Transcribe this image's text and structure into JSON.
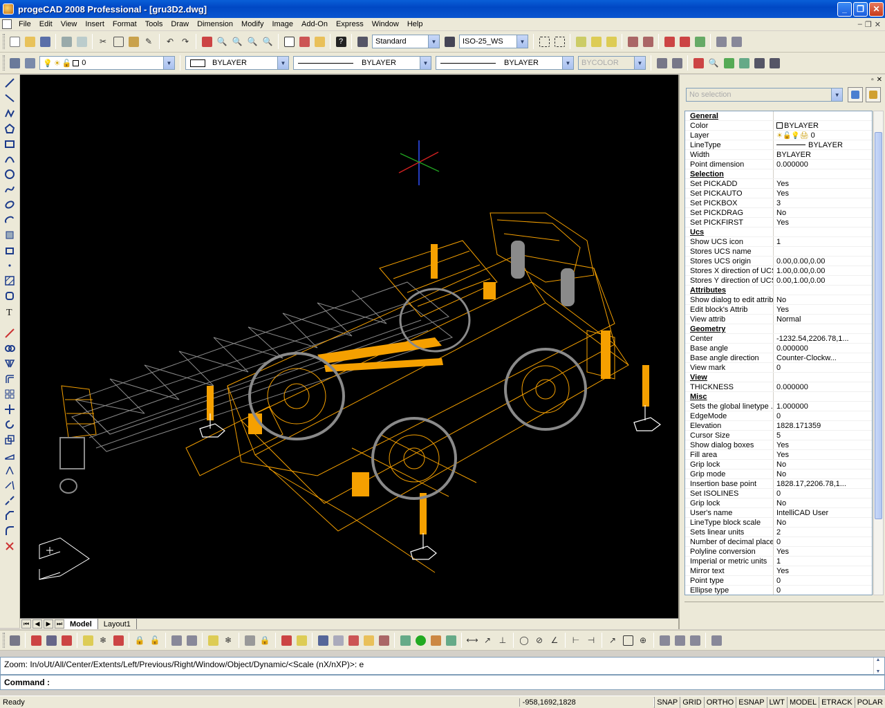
{
  "window": {
    "title": "progeCAD 2008 Professional - [gru3D2.dwg]"
  },
  "menu": [
    "File",
    "Edit",
    "View",
    "Insert",
    "Format",
    "Tools",
    "Draw",
    "Dimension",
    "Modify",
    "Image",
    "Add-On",
    "Express",
    "Window",
    "Help"
  ],
  "toolbar1": {
    "text_style": "Standard",
    "dim_style": "ISO-25_WS"
  },
  "toolbar2": {
    "layer": "0",
    "color": "BYLAYER",
    "linetype": "BYLAYER",
    "lineweight": "BYLAYER",
    "plotstyle": "BYCOLOR"
  },
  "properties": {
    "selection": "No selection",
    "rows": [
      {
        "k": "General",
        "v": "",
        "section": true
      },
      {
        "k": "Color",
        "v": "BYLAYER",
        "icon": "swatch"
      },
      {
        "k": "Layer",
        "v": "0",
        "icon": "layer"
      },
      {
        "k": "LineType",
        "v": "BYLAYER",
        "icon": "line"
      },
      {
        "k": "Width",
        "v": "BYLAYER"
      },
      {
        "k": "Point dimension",
        "v": "0.000000"
      },
      {
        "k": "Selection",
        "v": "",
        "section": true
      },
      {
        "k": "Set PICKADD",
        "v": "Yes"
      },
      {
        "k": "Set PICKAUTO",
        "v": "Yes"
      },
      {
        "k": "Set PICKBOX",
        "v": "3"
      },
      {
        "k": "Set PICKDRAG",
        "v": "No"
      },
      {
        "k": "Set PICKFIRST",
        "v": "Yes"
      },
      {
        "k": "Ucs",
        "v": "",
        "section": true
      },
      {
        "k": "Show UCS icon",
        "v": "1"
      },
      {
        "k": "Stores UCS name",
        "v": ""
      },
      {
        "k": "Stores UCS origin",
        "v": "0.00,0.00,0.00"
      },
      {
        "k": "Stores X direction of UCS",
        "v": "1.00,0.00,0.00"
      },
      {
        "k": "Stores Y direction of UCS",
        "v": "0.00,1.00,0.00"
      },
      {
        "k": "Attributes",
        "v": "",
        "section": true
      },
      {
        "k": "Show dialog to edit attrib",
        "v": "No"
      },
      {
        "k": "Edit block's Attrib",
        "v": "Yes"
      },
      {
        "k": "View attrib",
        "v": "Normal"
      },
      {
        "k": "Geometry",
        "v": "",
        "section": true
      },
      {
        "k": "Center",
        "v": "-1232.54,2206.78,1..."
      },
      {
        "k": "Base angle",
        "v": "0.000000"
      },
      {
        "k": "Base angle direction",
        "v": "Counter-Clockw..."
      },
      {
        "k": "View mark",
        "v": "0"
      },
      {
        "k": "View",
        "v": "",
        "section": true
      },
      {
        "k": "THICKNESS",
        "v": "0.000000"
      },
      {
        "k": "Misc",
        "v": "",
        "section": true
      },
      {
        "k": "Sets the global linetype ...",
        "v": "1.000000"
      },
      {
        "k": "EdgeMode",
        "v": "0"
      },
      {
        "k": "Elevation",
        "v": "1828.171359"
      },
      {
        "k": "Cursor Size",
        "v": "5"
      },
      {
        "k": "Show dialog boxes",
        "v": "Yes"
      },
      {
        "k": "Fill area",
        "v": "Yes"
      },
      {
        "k": "Grip lock",
        "v": "No"
      },
      {
        "k": "Grip mode",
        "v": "No"
      },
      {
        "k": "Insertion base point",
        "v": "1828.17,2206.78,1..."
      },
      {
        "k": "Set ISOLINES",
        "v": "0"
      },
      {
        "k": "Grip lock",
        "v": "No"
      },
      {
        "k": "User's name",
        "v": "IntelliCAD User"
      },
      {
        "k": "LineType block scale",
        "v": "No"
      },
      {
        "k": "Sets linear units",
        "v": "2"
      },
      {
        "k": "Number of decimal places",
        "v": "0"
      },
      {
        "k": "Polyline conversion",
        "v": "Yes"
      },
      {
        "k": "Imperial or metric units",
        "v": "1"
      },
      {
        "k": "Mirror text",
        "v": "Yes"
      },
      {
        "k": "Point type",
        "v": "0"
      },
      {
        "k": "Ellipse type",
        "v": "0"
      }
    ]
  },
  "tabs": [
    "Model",
    "Layout1"
  ],
  "command": {
    "history": "Zoom:  In/oUt/All/Center/Extents/Left/Previous/Right/Window/Object/Dynamic/<Scale (nX/nXP)>: e",
    "prompt": "Command :"
  },
  "status": {
    "ready": "Ready",
    "coords": "-958,1692,1828",
    "toggles": [
      "SNAP",
      "GRID",
      "ORTHO",
      "ESNAP",
      "LWT",
      "MODEL",
      "ETRACK",
      "POLAR"
    ]
  },
  "colors": {
    "wire": "#f5a000",
    "grey": "#8a8a8a",
    "canvas": "#000000"
  }
}
